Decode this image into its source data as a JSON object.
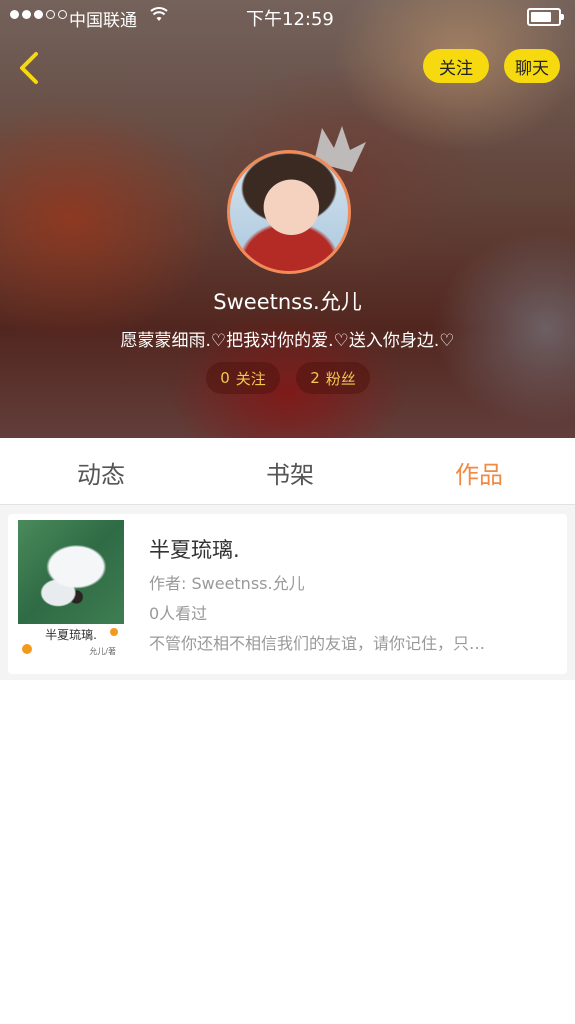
{
  "status_bar": {
    "carrier": "中国联通",
    "time": "下午12:59"
  },
  "header": {
    "follow_button": "关注",
    "chat_button": "聊天"
  },
  "profile": {
    "username": "Sweetnss.允儿",
    "bio": "愿蒙蒙细雨.♡把我对你的爱.♡送入你身边.♡",
    "following_count": "0",
    "following_label": "关注",
    "fans_count": "2",
    "fans_label": "粉丝"
  },
  "tabs": [
    {
      "label": "动态",
      "active": false
    },
    {
      "label": "书架",
      "active": false
    },
    {
      "label": "作品",
      "active": true
    }
  ],
  "works": [
    {
      "cover_title": "半夏琉璃.",
      "cover_author": "允儿/著",
      "title": "半夏琉璃.",
      "author": "作者: Sweetnss.允儿",
      "views": "0人看过",
      "description": "不管你还相不相信我们的友谊，请你记住，只…"
    }
  ],
  "colors": {
    "accent": "#f08a45",
    "button_yellow": "#f6d90f",
    "stat_text": "#f2c94c"
  }
}
